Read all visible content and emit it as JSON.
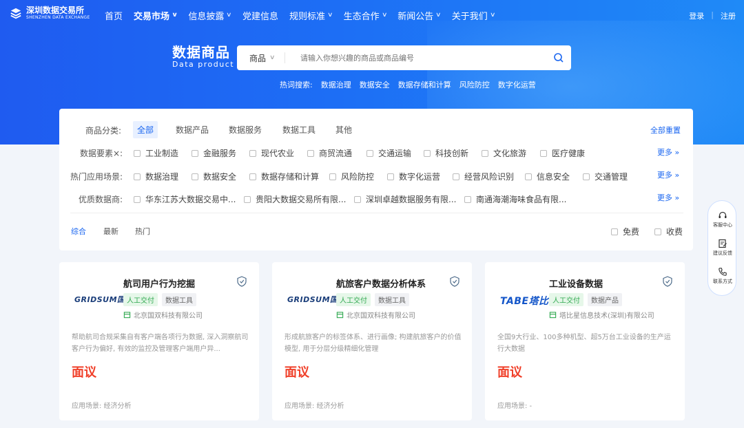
{
  "brand": {
    "name_cn": "深圳数据交易所",
    "name_en": "SHENZHEN DATA EXCHANGE"
  },
  "nav": {
    "items": [
      {
        "label": "首页",
        "dropdown": false,
        "active": false
      },
      {
        "label": "交易市场",
        "dropdown": true,
        "active": true
      },
      {
        "label": "信息披露",
        "dropdown": true,
        "active": false
      },
      {
        "label": "党建信息",
        "dropdown": false,
        "active": false
      },
      {
        "label": "规则标准",
        "dropdown": true,
        "active": false
      },
      {
        "label": "生态合作",
        "dropdown": true,
        "active": false
      },
      {
        "label": "新闻公告",
        "dropdown": true,
        "active": false
      },
      {
        "label": "关于我们",
        "dropdown": true,
        "active": false
      }
    ],
    "login": "登录",
    "register": "注册"
  },
  "hero": {
    "title_cn": "数据商品",
    "title_en": "Data product",
    "search": {
      "type": "商品",
      "placeholder": "请输入你想兴趣的商品或商品编号"
    },
    "hot_label": "热词搜索:",
    "hot_words": [
      "数据治理",
      "数据安全",
      "数据存储和计算",
      "风险防控",
      "数字化运营"
    ]
  },
  "filters": {
    "category": {
      "label": "商品分类:",
      "options": [
        "全部",
        "数据产品",
        "数据服务",
        "数据工具",
        "其他"
      ],
      "selected": "全部"
    },
    "reset": "全部重置",
    "elements": {
      "label": "数据要素×:",
      "options": [
        "工业制造",
        "金融服务",
        "现代农业",
        "商贸流通",
        "交通运输",
        "科技创新",
        "文化旅游",
        "医疗健康"
      ],
      "more": "更多"
    },
    "scenarios": {
      "label": "热门应用场景:",
      "options": [
        "数据治理",
        "数据安全",
        "数据存储和计算",
        "风险防控",
        "数字化运营",
        "经营风险识别",
        "信息安全",
        "交通管理"
      ],
      "more": "更多"
    },
    "vendors": {
      "label": "优质数据商:",
      "options": [
        "华东江苏大数据交易中...",
        "贵阳大数据交易所有限...",
        "深圳卓越数据服务有限...",
        "南通海潮海味食品有限..."
      ],
      "more": "更多"
    },
    "sort": {
      "options": [
        "综合",
        "最新",
        "热门"
      ],
      "selected": "综合"
    },
    "price": {
      "free": "免费",
      "paid": "收费"
    }
  },
  "cards": [
    {
      "brand": "GRIDSUM国双",
      "title": "航司用户行为挖掘",
      "tags": [
        "人工交付",
        "数据工具"
      ],
      "company": "北京国双科技有限公司",
      "desc": "帮助航司合规采集自有客户端各项行为数据, 深入洞察航司客户行为偏好, 有效的监控及管理客户端用户异...",
      "price": "面议",
      "scene": "应用场景: 经济分析"
    },
    {
      "brand": "GRIDSUM国双",
      "title": "航旅客户数据分析体系",
      "tags": [
        "人工交付",
        "数据工具"
      ],
      "company": "北京国双科技有限公司",
      "desc": "形成航旅客户的标签体系、进行画像; 构建航旅客户的价值模型, 用于分层分级精细化管理",
      "price": "面议",
      "scene": "应用场景: 经济分析"
    },
    {
      "brand": "TABE塔比星",
      "title": "工业设备数据",
      "tags": [
        "人工交付",
        "数据产品"
      ],
      "company": "塔比星信息技术(深圳)有限公司",
      "desc": "全国9大行业、100多种机型、超5万台工业设备的生产运行大数据",
      "price": "面议",
      "scene": "应用场景: -"
    }
  ],
  "side": {
    "service": "客服中心",
    "feedback": "建议反馈",
    "contact": "联系方式"
  },
  "colors": {
    "accent": "#1a66f0",
    "price": "#f0402a",
    "tag_green": "#2fa84f"
  }
}
